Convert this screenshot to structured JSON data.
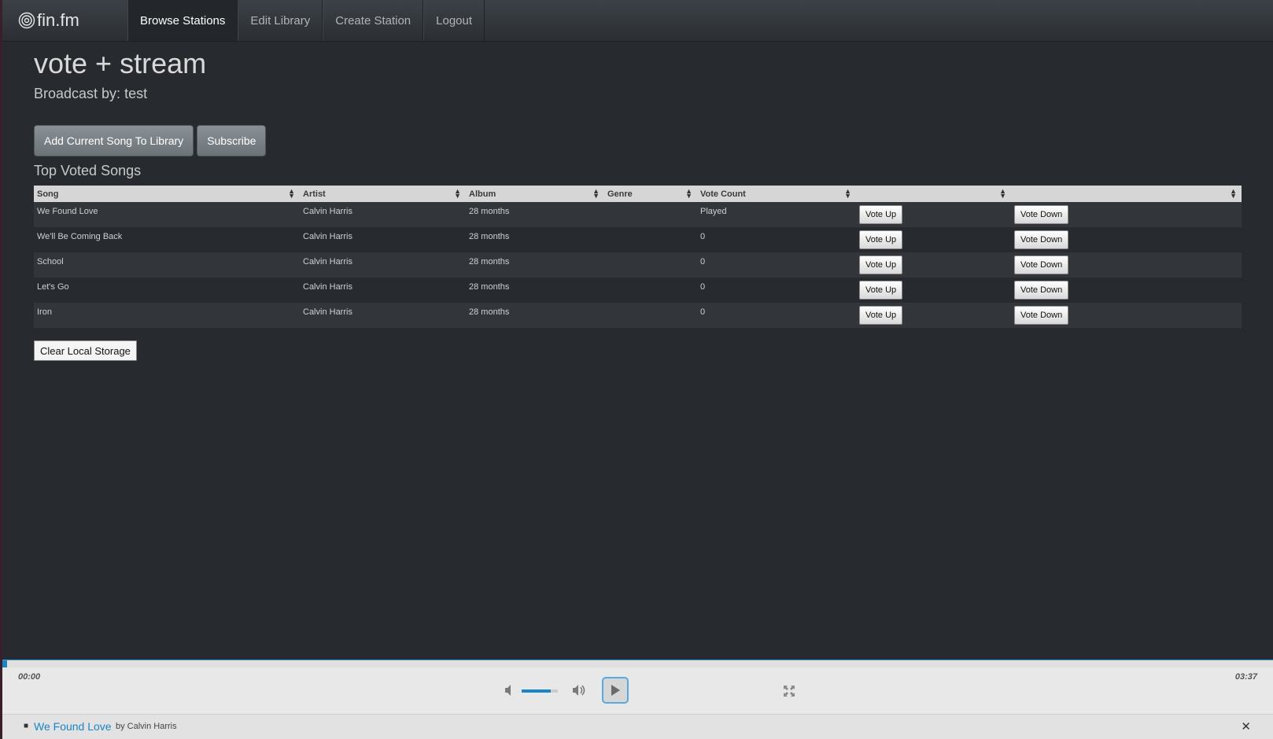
{
  "brand": {
    "name": "fin.fm",
    "icon": "target-icon"
  },
  "nav": [
    {
      "label": "Browse Stations",
      "active": true
    },
    {
      "label": "Edit Library"
    },
    {
      "label": "Create Station"
    },
    {
      "label": "Logout"
    }
  ],
  "station": {
    "title": "vote + stream",
    "broadcast_label": "Broadcast by:",
    "broadcaster": "test"
  },
  "buttons": {
    "add_song": "Add Current Song To Library",
    "subscribe": "Subscribe",
    "clear_storage": "Clear Local Storage"
  },
  "section_title": "Top Voted Songs",
  "table": {
    "columns": [
      "Song",
      "Artist",
      "Album",
      "Genre",
      "Vote Count",
      "",
      ""
    ],
    "vote_up_label": "Vote Up",
    "vote_down_label": "Vote Down",
    "rows": [
      {
        "song": "We Found Love",
        "artist": "Calvin Harris",
        "album": "28 months",
        "genre": "",
        "votes": "Played"
      },
      {
        "song": "We'll Be Coming Back",
        "artist": "Calvin Harris",
        "album": "28 months",
        "genre": "",
        "votes": "0"
      },
      {
        "song": "School",
        "artist": "Calvin Harris",
        "album": "28 months",
        "genre": "",
        "votes": "0"
      },
      {
        "song": "Let's Go",
        "artist": "Calvin Harris",
        "album": "28 months",
        "genre": "",
        "votes": "0"
      },
      {
        "song": "Iron",
        "artist": "Calvin Harris",
        "album": "28 months",
        "genre": "",
        "votes": "0"
      }
    ]
  },
  "player": {
    "current_time": "00:00",
    "duration": "03:37",
    "progress_percent": 0.4,
    "volume_percent": 80,
    "accent": "#1a86c8"
  },
  "now_playing": {
    "song": "We Found Love",
    "by_label": "by Calvin Harris",
    "close_icon": "close-icon"
  }
}
